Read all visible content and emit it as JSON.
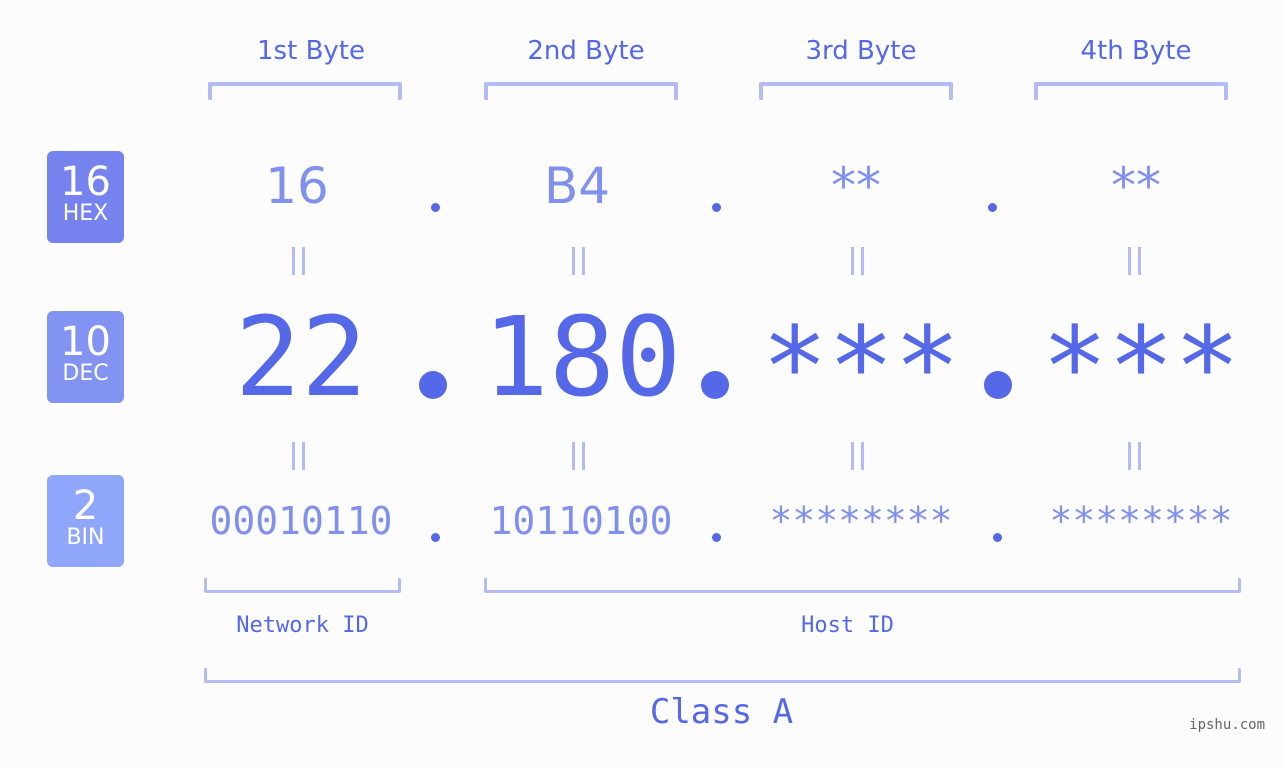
{
  "byte_headers": [
    "1st Byte",
    "2nd Byte",
    "3rd Byte",
    "4th Byte"
  ],
  "rows": {
    "hex": {
      "base": "16",
      "label": "HEX",
      "values": [
        "16",
        "B4",
        "**",
        "**"
      ],
      "color": "#7683ee"
    },
    "dec": {
      "base": "10",
      "label": "DEC",
      "values": [
        "22",
        "180",
        "***",
        "***"
      ],
      "color": "#8393f2"
    },
    "bin": {
      "base": "2",
      "label": "BIN",
      "values": [
        "00010110",
        "10110100",
        "********",
        "********"
      ],
      "color": "#8fa6fa"
    }
  },
  "segments": {
    "network_id": "Network ID",
    "host_id": "Host ID",
    "class": "Class A"
  },
  "watermark": "ipshu.com"
}
